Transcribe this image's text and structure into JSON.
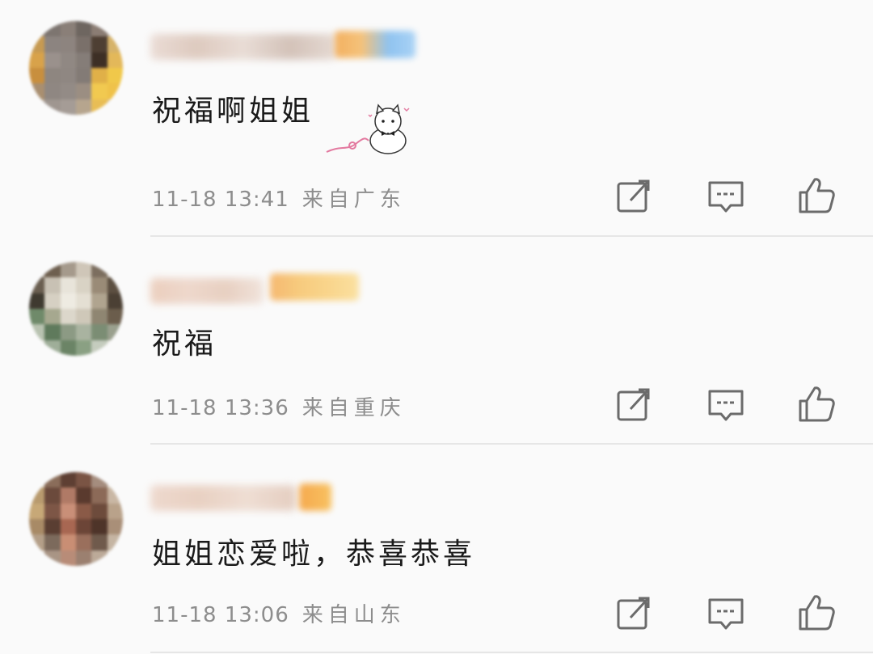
{
  "comments": [
    {
      "text": "祝福啊姐姐",
      "time": "11-18 13:41",
      "location": "来自广东",
      "has_sticker": true
    },
    {
      "text": "祝福",
      "time": "11-18 13:36",
      "location": "来自重庆",
      "has_sticker": false
    },
    {
      "text": "姐姐恋爱啦，恭喜恭喜",
      "time": "11-18 13:06",
      "location": "来自山东",
      "has_sticker": false
    }
  ],
  "icons": {
    "share": "share-icon",
    "comment": "comment-icon",
    "like": "like-icon"
  },
  "colors": {
    "text": "#1a1a1a",
    "meta": "#8d8d8d",
    "icon": "#6b6b6b",
    "divider": "#e6e6e6"
  }
}
